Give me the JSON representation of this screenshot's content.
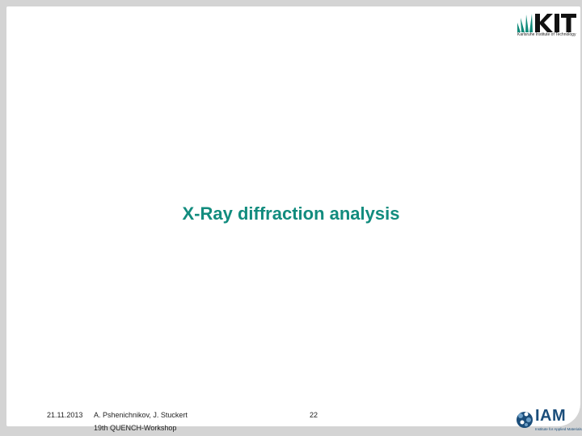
{
  "title": "X-Ray diffraction analysis",
  "footer": {
    "date": "21.11.2013",
    "authors": "A. Pshenichnikov, J. Stuckert",
    "workshop": "19th QUENCH-Workshop",
    "page_number": "22"
  },
  "logos": {
    "kit": {
      "wordmark": "KIT",
      "tagline": "Karlsruhe Institute of Technology",
      "color_green": "#0f8a79",
      "color_black": "#111111"
    },
    "iam": {
      "wordmark": "IAM",
      "subtitle": "Institute for Applied Materials",
      "color": "#1a4d7a"
    }
  },
  "colors": {
    "title": "#128c7e",
    "background_frame": "#d4d4d4",
    "slide": "#ffffff"
  }
}
